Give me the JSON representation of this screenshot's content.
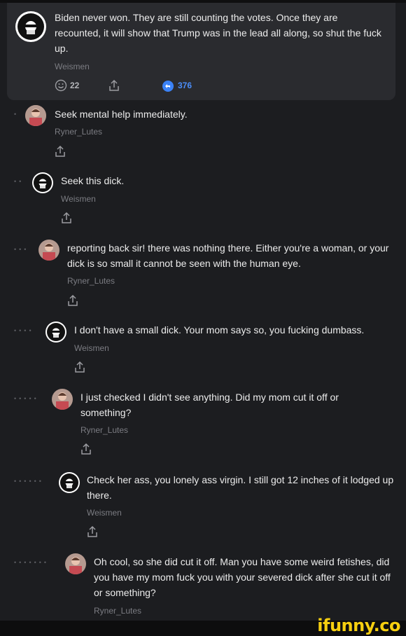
{
  "post": {
    "text": "Biden never won. They are still counting the votes. Once they are recounted, it will show that Trump was in the lead all along, so shut the fuck up.",
    "username": "Weismen",
    "smiles": "22",
    "replies": "376"
  },
  "comments": [
    {
      "text": "Seek mental help immediately.",
      "username": "Ryner_Lutes",
      "depth": 1
    },
    {
      "text": "Seek this dick.",
      "username": "Weismen",
      "depth": 2
    },
    {
      "text": "reporting back sir! there was nothing there. Either you're a woman, or your dick is so small it cannot be seen with the human eye.",
      "username": "Ryner_Lutes",
      "depth": 3
    },
    {
      "text": "I don't have a small dick. Your mom says so, you fucking dumbass.",
      "username": "Weismen",
      "depth": 4
    },
    {
      "text": "I just checked I didn't see anything. Did my mom cut it off or something?",
      "username": "Ryner_Lutes",
      "depth": 5
    },
    {
      "text": "Check her ass, you lonely ass virgin. I still got 12 inches of it lodged up there.",
      "username": "Weismen",
      "depth": 6
    },
    {
      "text": "Oh cool, so she did cut it off. Man you have some weird fetishes, did you have my mom fuck you with your severed dick after she cut it off or something?",
      "username": "Ryner_Lutes",
      "depth": 7
    }
  ],
  "watermark": "ifunny.co",
  "colors": {
    "accent_blue": "#3b82f6",
    "muted": "#7b7c82",
    "watermark": "#f6cf10"
  }
}
